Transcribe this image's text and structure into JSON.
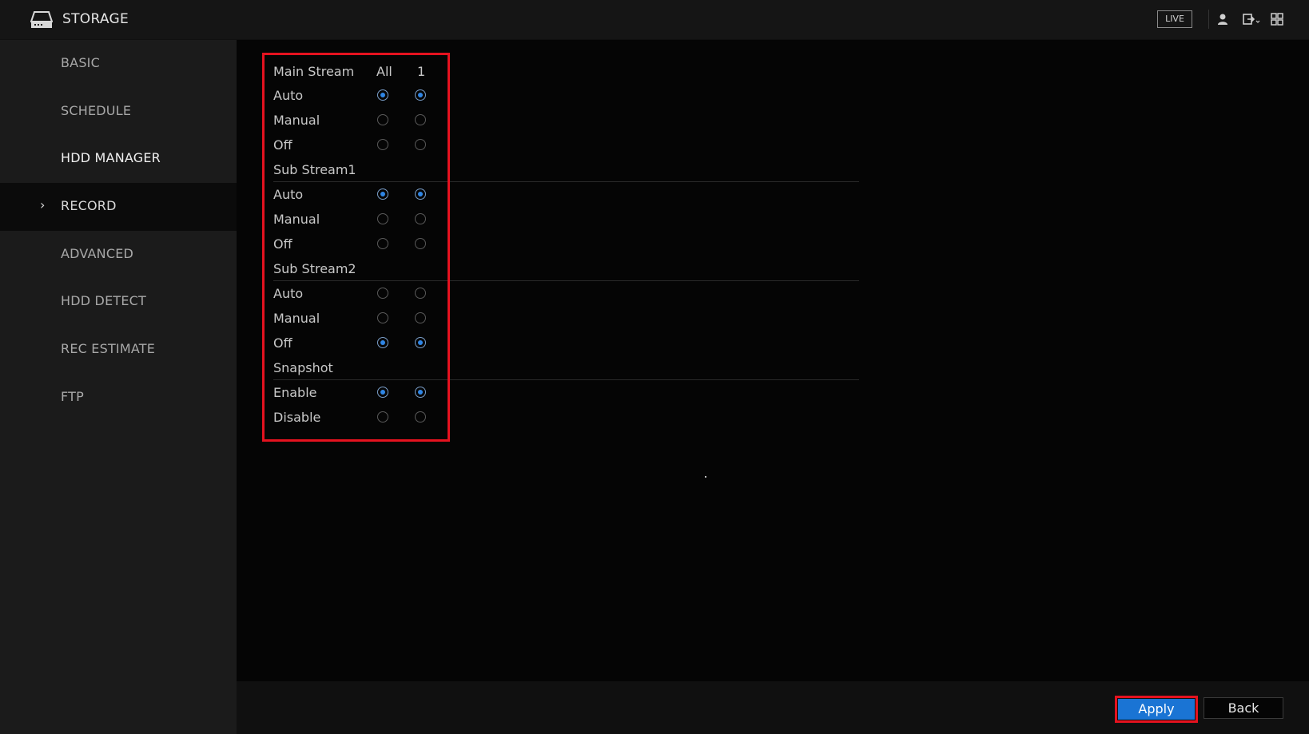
{
  "header": {
    "title": "STORAGE",
    "live_label": "LIVE",
    "icons": [
      "storage-icon",
      "user-icon",
      "logout-icon",
      "grid-menu-icon"
    ]
  },
  "sidebar": {
    "items": [
      {
        "label": "BASIC"
      },
      {
        "label": "SCHEDULE"
      },
      {
        "label": "HDD MANAGER"
      },
      {
        "label": "RECORD",
        "chevron": "›"
      },
      {
        "label": "ADVANCED"
      },
      {
        "label": "HDD DETECT"
      },
      {
        "label": "REC ESTIMATE"
      },
      {
        "label": "FTP"
      }
    ],
    "active": "RECORD"
  },
  "record": {
    "columns": [
      "All",
      "1"
    ],
    "sections": [
      {
        "title": "Main Stream",
        "options": [
          {
            "label": "Auto",
            "all": true,
            "ch1": true
          },
          {
            "label": "Manual",
            "all": false,
            "ch1": false
          },
          {
            "label": "Off",
            "all": false,
            "ch1": false
          }
        ]
      },
      {
        "title": "Sub Stream1",
        "options": [
          {
            "label": "Auto",
            "all": true,
            "ch1": true
          },
          {
            "label": "Manual",
            "all": false,
            "ch1": false
          },
          {
            "label": "Off",
            "all": false,
            "ch1": false
          }
        ]
      },
      {
        "title": "Sub Stream2",
        "options": [
          {
            "label": "Auto",
            "all": false,
            "ch1": false
          },
          {
            "label": "Manual",
            "all": false,
            "ch1": false
          },
          {
            "label": "Off",
            "all": true,
            "ch1": true
          }
        ]
      },
      {
        "title": "Snapshot",
        "options": [
          {
            "label": "Enable",
            "all": true,
            "ch1": true
          },
          {
            "label": "Disable",
            "all": false,
            "ch1": false
          }
        ]
      }
    ]
  },
  "footer": {
    "apply_label": "Apply",
    "back_label": "Back"
  },
  "colors": {
    "accent": "#1a74d4",
    "highlight": "#e5121f",
    "radio_on": "#2f86e6"
  }
}
